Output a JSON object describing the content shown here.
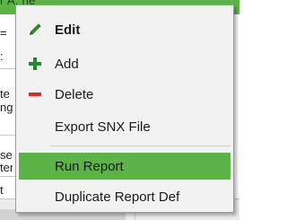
{
  "background": {
    "topbar_text": "r  A.      ne",
    "fragments": [
      "=",
      ":",
      "te",
      "ng",
      "se",
      "ter",
      "t"
    ]
  },
  "context_menu": {
    "items": [
      {
        "label": "Edit",
        "icon": "pencil-icon",
        "bold": true,
        "highlighted": false
      },
      {
        "label": "Add",
        "icon": "plus-icon",
        "bold": false,
        "highlighted": false
      },
      {
        "label": "Delete",
        "icon": "minus-icon",
        "bold": false,
        "highlighted": false
      },
      {
        "label": "Export SNX File",
        "icon": "",
        "bold": false,
        "highlighted": false
      },
      {
        "label": "Run Report",
        "icon": "",
        "bold": false,
        "highlighted": true
      },
      {
        "label": "Duplicate Report Def",
        "icon": "",
        "bold": false,
        "highlighted": false
      }
    ]
  },
  "colors": {
    "accent_green": "#5cb447",
    "delete_red": "#d92b2b",
    "add_green": "#1f8a2a",
    "pencil_green": "#2f8a2f"
  }
}
